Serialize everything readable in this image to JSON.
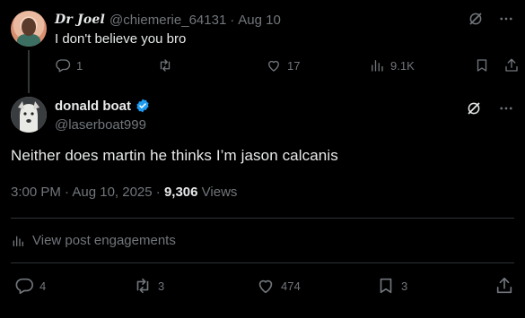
{
  "reply": {
    "display_name": "Dr Joel",
    "handle": "@chiemerie_64131",
    "separator": "·",
    "date": "Aug 10",
    "text": "I don't believe you bro",
    "replies": "1",
    "reposts": "",
    "likes": "17",
    "views": "9.1K"
  },
  "main": {
    "display_name": "donald boat",
    "handle": "@laserboat999",
    "text": "Neither does martin he thinks I’m jason calcanis",
    "time": "3:00 PM · Aug 10, 2025 · ",
    "views_count": "9,306",
    "views_label": " Views",
    "engagements_link": "View post engagements",
    "replies": "4",
    "reposts": "3",
    "likes": "474",
    "bookmarks": "3"
  },
  "colors": {
    "verified": "#1d9bf0",
    "muted": "#71767b",
    "text": "#e7e9ea",
    "background": "#000000"
  },
  "icons": [
    "grok-icon",
    "more-icon",
    "reply-icon",
    "repost-icon",
    "like-icon",
    "views-icon",
    "bookmark-icon",
    "share-icon",
    "verified-badge-icon",
    "analytics-icon"
  ]
}
